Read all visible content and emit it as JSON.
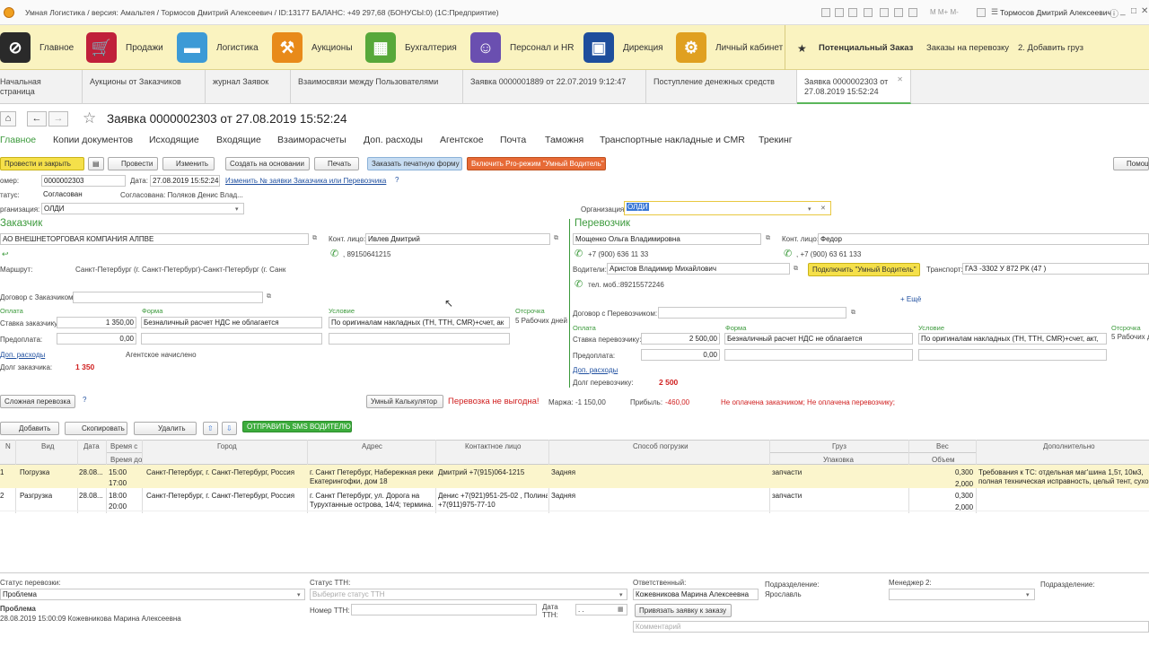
{
  "window": {
    "title": "Умная Логистика / версия: Амальтея / Тормосов Дмитрий Алексеевич / ID:13177 БАЛАНС: +49 297,68 (БОНУСЫ:0)  (1С:Предприятие)",
    "user": "Тормосов Дмитрий Алексеевич"
  },
  "sections": [
    {
      "label": "Главное",
      "icon": "paperclip-icon",
      "color": "#2a2a2a"
    },
    {
      "label": "Продажи",
      "icon": "cart-icon",
      "color": "#c0203a"
    },
    {
      "label": "Логистика",
      "icon": "truck-icon",
      "color": "#3c9ad6"
    },
    {
      "label": "Аукционы",
      "icon": "gavel-icon",
      "color": "#e88a1a"
    },
    {
      "label": "Бухгалтерия",
      "icon": "calculator-icon",
      "color": "#57a83a"
    },
    {
      "label": "Персонал и HR",
      "icon": "people-icon",
      "color": "#6a4fb0"
    },
    {
      "label": "Дирекция",
      "icon": "briefcase-icon",
      "color": "#1e4e9c"
    },
    {
      "label": "Личный кабинет",
      "icon": "gear-icon",
      "color": "#e0a020"
    }
  ],
  "favorites": {
    "potential": "Потенциальный Заказ",
    "orders": "Заказы на перевозку",
    "addcargo": "2. Добавить груз"
  },
  "tabs": [
    {
      "label": "Начальная страница"
    },
    {
      "label": "Аукционы от Заказчиков"
    },
    {
      "label": "журнал Заявок"
    },
    {
      "label": "Взаимосвязи между Пользователями"
    },
    {
      "label": "Заявка 0000001889 от 22.07.2019 9:12:47"
    },
    {
      "label": "Поступление денежных средств"
    },
    {
      "label": "Заявка 0000002303 от 27.08.2019 15:52:24"
    }
  ],
  "doc": {
    "title": "Заявка 0000002303 от 27.08.2019 15:52:24"
  },
  "menu": [
    "Главное",
    "Копии документов",
    "Исходящие",
    "Входящие",
    "Взаиморасчеты",
    "Доп. расходы",
    "Агентское",
    "Почта",
    "Таможня",
    "Транспортные накладные и CMR",
    "Трекинг"
  ],
  "toolbar": {
    "post_close": "Провести и закрыть",
    "post": "Провести",
    "edit": "Изменить",
    "create_based": "Создать на основании",
    "print": "Печать",
    "order_print": "Заказать печатную форму",
    "pro_mode": "Включить Pro-режим \"Умный Водитель\"",
    "help": "Помощ"
  },
  "header": {
    "number_label": "омер:",
    "number": "0000002303",
    "date_label": "Дата:",
    "date": "27.08.2019 15:52:24",
    "change_link": "Изменить № заявки Заказчика или Перевозчика",
    "q": "?",
    "status_label": "татус:",
    "status": "Согласован",
    "approved": "Согласована: Поляков Денис Влад...",
    "org_label": "рганизация:",
    "org": "ОЛДИ",
    "org2_label": "Организация:",
    "org2": "ОЛДИ"
  },
  "customer": {
    "header": "Заказчик",
    "name": "АО ВНЕШНЕТОРГОВАЯ КОМПАНИЯ АЛПВЕ",
    "contact_label": "Конт. лицо:",
    "contact": "Ивлев Дмитрий",
    "phone": ", 89150641215",
    "route_label": "Маршрут:",
    "route": "Санкт-Петербург (г. Санкт-Петербург)-Санкт-Петербург (г. Санк",
    "contract_label": "Договор с Заказчиком:",
    "payment": "Оплата",
    "form": "Форма",
    "condition": "Условие",
    "delay": "Отсрочка",
    "rate_label": "Ставка заказчику:",
    "rate": "1 350,00",
    "form_val": "Безналичный расчет НДС не облагается",
    "cond_val": "По оригиналам накладных (ТН, ТТН, CMR)+счет, ак",
    "delay_val": "5 Рабочих дней",
    "prepay_label": "Предоплата:",
    "prepay": "0,00",
    "extra": "Доп. расходы",
    "agent": "Агентское начислено",
    "debt_label": "Долг заказчика:",
    "debt": "1 350"
  },
  "carrier": {
    "header": "Перевозчик",
    "name": "Мощенко Ольга Владимировна",
    "contact_label": "Конт. лицо:",
    "contact": "Федор",
    "phone1": "+7 (900) 636 11 33",
    "phone2": ", +7 (900) 63 61 133",
    "drivers_label": "Водители:",
    "driver": "Аристов Владимир Михайлович",
    "connect": "Подключить \"Умный Водитель\"",
    "transport_label": "Транспорт:",
    "transport": "ГАЗ -3302   У 872 РК (47 )",
    "mob": "тел. моб.:89215572246",
    "more": "+ Ещё",
    "contract_label": "Договор с Перевозчиком:",
    "payment": "Оплата",
    "form": "Форма",
    "condition": "Условие",
    "delay": "Отсрочка",
    "rate_label": "Ставка перевозчику:",
    "rate": "2 500,00",
    "form_val": "Безналичный расчет НДС не облагается",
    "cond_val": "По оригиналам накладных (ТН, ТТН, CMR)+счет, акт,",
    "delay_val": "5 Рабочих д",
    "prepay_label": "Предоплата:",
    "prepay": "0,00",
    "extra": "Доп. расходы",
    "debt_label": "Долг перевозчику:",
    "debt": "2 500"
  },
  "summary": {
    "complex": "Сложная перевозка",
    "q": "?",
    "calc": "Умный Калькулятор",
    "unprofitable": "Перевозка не выгодна!",
    "margin_label": "Маржа:",
    "margin": "-1 150,00",
    "profit_label": "Прибыль:",
    "profit": "-460,00",
    "unpaid": "Не оплачена заказчиком; Не оплачена перевозчику;"
  },
  "gridtools": {
    "add": "Добавить",
    "copy": "Скопировать",
    "delete": "Удалить",
    "sms": "ОТПРАВИТЬ SMS ВОДИТЕЛЮ"
  },
  "columns": {
    "n": "N",
    "kind": "Вид",
    "date": "Дата",
    "time_from": "Время с",
    "time_to": "Время до",
    "city": "Город",
    "address": "Адрес",
    "contact": "Контактное лицо",
    "loading": "Способ погрузки",
    "cargo": "Груз",
    "pack": "Упаковка",
    "weight": "Вес",
    "volume": "Объем",
    "extra": "Дополнительно"
  },
  "rows": [
    {
      "n": "1",
      "kind": "Погрузка",
      "date": "28.08...",
      "t1": "15:00",
      "t2": "17:00",
      "city": "Санкт-Петербург, г. Санкт-Петербург, Россия",
      "addr1": "г. Санкт Петербург, Набережная реки",
      "addr2": "Екатерингофки, дом 18",
      "contact1": "Дмитрий +7(915)064-1215",
      "contact2": "",
      "loading": "Задняя",
      "cargo": "запчасти",
      "w": "0,300",
      "v": "2,000",
      "extra1": "Требования к ТС: отдельная маг'шина 1,5т, 10м3,",
      "extra2": "полная техническая исправность, целый тент, сухой,"
    },
    {
      "n": "2",
      "kind": "Разгрузка",
      "date": "28.08...",
      "t1": "18:00",
      "t2": "20:00",
      "city": "Санкт-Петербург, г. Санкт-Петербург, Россия",
      "addr1": "г. Санкт Петербург, ул. Дорога на",
      "addr2": "Турухтанные острова, 14/4; термина...",
      "contact1": "Денис +7(921)951-25-02 , Полина",
      "contact2": "+7(911)975-77-10",
      "loading": "Задняя",
      "cargo": "запчасти",
      "w": "0,300",
      "v": "2,000",
      "extra1": "",
      "extra2": ""
    }
  ],
  "footer": {
    "transport_status_label": "Статус перевозки:",
    "transport_status": "Проблема",
    "problem_title": "Проблема",
    "problem_note": "28.08.2019 15:00:09 Кожевникова Марина Алексеевна",
    "ttn_status_label": "Статус ТТН:",
    "ttn_status_ph": "Выберите статус ТТН",
    "ttn_num_label": "Номер ТТН:",
    "ttn_date_label": "Дата ТТН:",
    "ttn_date": " .  .  ",
    "resp_label": "Ответственный:",
    "resp": "Кожевникова Марина Алексеевна",
    "bind": "Привязать заявку к заказу",
    "dept_label": "Подразделение:",
    "dept": "Ярославль",
    "mgr2_label": "Менеджер 2:",
    "dept2_label": "Подразделение:",
    "comment_ph": "Комментарий"
  }
}
